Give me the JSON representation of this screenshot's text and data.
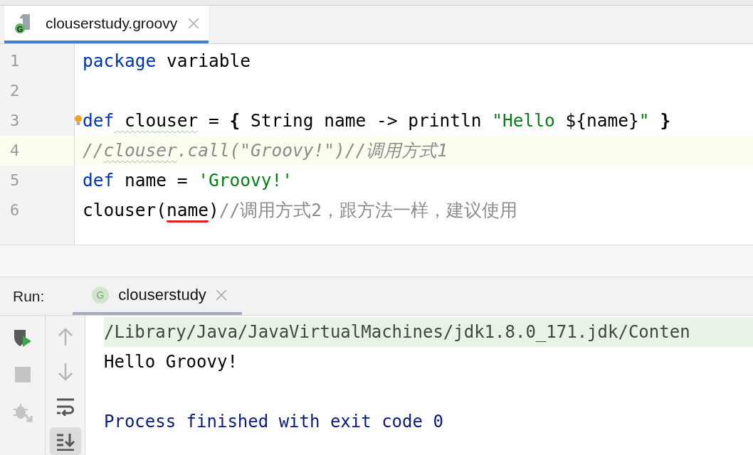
{
  "editor_tab": {
    "label": "clouserstudy.groovy",
    "icon_letter": "G",
    "selected": true
  },
  "code_lines": [
    {
      "number": "1",
      "current": false,
      "bulb": false,
      "tokens": [
        {
          "t": "package",
          "kind": "keyword"
        },
        {
          "t": " variable",
          "kind": "plain"
        }
      ]
    },
    {
      "number": "2",
      "current": false,
      "bulb": false
    },
    {
      "number": "3",
      "current": false,
      "bulb": true,
      "tokens": [
        {
          "t": "def",
          "kind": "keyword"
        },
        {
          "t": " clouser",
          "kind": "plain",
          "warn": true
        },
        {
          "t": " = ",
          "kind": "plain",
          "warn": false
        },
        {
          "t": "{",
          "kind": "brace"
        },
        {
          "t": " String name -> println ",
          "kind": "plain",
          "warn": false
        },
        {
          "t": "\"Hello ",
          "kind": "string"
        },
        {
          "t": "${name}",
          "kind": "plain",
          "warn": false
        },
        {
          "t": "\"",
          "kind": "string"
        },
        {
          "t": " }",
          "kind": "brace"
        }
      ]
    },
    {
      "number": "4",
      "current": true,
      "bulb": false,
      "tokens": [
        {
          "t": "//",
          "kind": "comment",
          "warn": false
        },
        {
          "t": "clouser",
          "kind": "comment",
          "warn": true
        },
        {
          "t": ".call(\"Groovy!\")//调用方式1",
          "kind": "comment",
          "warn": false
        }
      ]
    },
    {
      "number": "5",
      "current": false,
      "bulb": false,
      "tokens": [
        {
          "t": "def",
          "kind": "keyword"
        },
        {
          "t": " name = ",
          "kind": "plain",
          "warn": false
        },
        {
          "t": "'Groovy!'",
          "kind": "string"
        }
      ]
    },
    {
      "number": "6",
      "current": false,
      "bulb": false,
      "tokens": [
        {
          "t": "clouser(",
          "kind": "plain",
          "error": false
        },
        {
          "t": "name",
          "kind": "plain",
          "error": true
        },
        {
          "t": ")",
          "kind": "plain",
          "error": false
        },
        {
          "t": "//调用方式2，跟方法一样，建议使用",
          "kind": "chinese-comment"
        }
      ]
    }
  ],
  "run_panel": {
    "label": "Run:",
    "tab": {
      "label": "clouserstudy",
      "icon_letter": "G",
      "selected": true
    }
  },
  "console_lines": [
    {
      "text": "/Library/Java/JavaVirtualMachines/jdk1.8.0_171.jdk/Conten",
      "kind": "command"
    },
    {
      "text": "Hello Groovy!",
      "kind": "output"
    },
    {
      "text": "Process finished with exit code 0",
      "kind": "exit"
    }
  ],
  "toolbar_left": [
    {
      "kind": "rerun"
    },
    {
      "kind": "stop"
    },
    {
      "kind": "debug"
    }
  ],
  "toolbar_right": [
    {
      "kind": "up",
      "selected": false
    },
    {
      "kind": "down",
      "selected": false
    },
    {
      "kind": "wrap",
      "selected": false
    },
    {
      "kind": "scroll-end",
      "selected": true
    }
  ]
}
